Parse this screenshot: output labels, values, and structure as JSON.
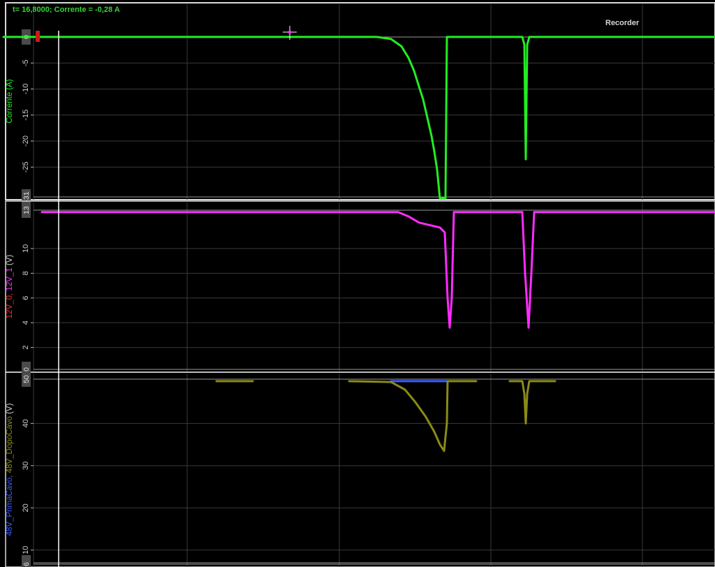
{
  "header": {
    "readout": "t= 16,8000; Corrente = -0,28 A",
    "recorder_label": "Recorder"
  },
  "colors": {
    "background": "#000000",
    "grid": "#3a3a3a",
    "panel_border": "#d8d8d8",
    "current": "#22ee22",
    "v12_0": "#e03030",
    "v12_1": "#ff2cff",
    "v48_prima": "#3a5cff",
    "v48_dopo": "#8a8a1a",
    "cursor": "#ffffff"
  },
  "chart_data": [
    {
      "type": "line",
      "panel": "current",
      "ylabel": "Corrente (A)",
      "ylim": [
        -31,
        1.2
      ],
      "yticks": [
        0,
        -5,
        -10,
        -15,
        -20,
        -25
      ],
      "ytick_labels": [
        "0",
        "-5",
        "-10",
        "-15",
        "-20",
        "-25"
      ],
      "ytick_boxed": [
        {
          "value": 0,
          "label": "0"
        },
        {
          "value": -31,
          "label": "-31"
        }
      ],
      "grid": true,
      "series": [
        {
          "name": "Corrente",
          "color": "#22ee22",
          "points": [
            [
              5,
              0
            ],
            [
              540,
              0
            ],
            [
              560,
              -0.4
            ],
            [
              575,
              -1.8
            ],
            [
              585,
              -4
            ],
            [
              593,
              -6.5
            ],
            [
              600,
              -9.5
            ],
            [
              606,
              -12
            ],
            [
              612,
              -15.5
            ],
            [
              618,
              -19
            ],
            [
              622,
              -22
            ],
            [
              626,
              -25.5
            ],
            [
              630,
              -31
            ],
            [
              634,
              -31
            ],
            [
              638,
              -31
            ],
            [
              640,
              0
            ],
            [
              645,
              0
            ],
            [
              748,
              0
            ],
            [
              751,
              -1.5
            ],
            [
              753,
              -23.5
            ],
            [
              755,
              -1.5
            ],
            [
              758,
              0
            ],
            [
              1024,
              0
            ]
          ]
        }
      ]
    },
    {
      "type": "line",
      "panel": "12v",
      "ylabel_parts": [
        {
          "text": "12V_0, ",
          "color": "#e03030"
        },
        {
          "text": "12V_1",
          "color": "#ff2cff"
        },
        {
          "text": " (V)",
          "color": "#d0d0d0"
        }
      ],
      "ylim": [
        0,
        13.1
      ],
      "yticks": [
        10,
        8,
        6,
        4,
        2
      ],
      "ytick_labels": [
        "10",
        "8",
        "6",
        "4",
        "2"
      ],
      "ytick_boxed": [
        {
          "value": 13.1,
          "label": "13"
        },
        {
          "value": 0,
          "label": "0"
        }
      ],
      "grid": true,
      "series": [
        {
          "name": "12V_1",
          "color": "#ff2cff",
          "points": [
            [
              60,
              12.95
            ],
            [
              570,
              12.95
            ],
            [
              585,
              12.6
            ],
            [
              600,
              12.1
            ],
            [
              615,
              11.9
            ],
            [
              630,
              11.7
            ],
            [
              637,
              11.3
            ],
            [
              641,
              6
            ],
            [
              644,
              3.6
            ],
            [
              647,
              6
            ],
            [
              650,
              12.95
            ],
            [
              748,
              12.95
            ],
            [
              752,
              8
            ],
            [
              757,
              3.6
            ],
            [
              761,
              8
            ],
            [
              765,
              12.95
            ],
            [
              1024,
              12.95
            ]
          ]
        }
      ]
    },
    {
      "type": "line",
      "panel": "48v",
      "ylabel_parts": [
        {
          "text": "48V_PrimaCavo",
          "color": "#3a5cff"
        },
        {
          "text": ", 48V_DopoCavo",
          "color": "#8a8a1a"
        },
        {
          "text": " (V)",
          "color": "#d0d0d0"
        }
      ],
      "ylim": [
        6,
        51.3
      ],
      "yticks": [
        40,
        30,
        20,
        10
      ],
      "ytick_labels": [
        "40",
        "30",
        "20",
        "10"
      ],
      "ytick_boxed": [
        {
          "value": 50.5,
          "label": "50"
        },
        {
          "value": 7,
          "label": "7.0"
        },
        {
          "value": 6,
          "label": "6"
        }
      ],
      "grid": true,
      "series": [
        {
          "name": "48V_PrimaCavo",
          "color": "#3a5cff",
          "points": [
            [
              560,
              50
            ],
            [
              640,
              50
            ]
          ]
        },
        {
          "name": "48V_DopoCavo",
          "color": "#8a8a1a",
          "segments": [
            [
              [
                310,
                50
              ],
              [
                362,
                50
              ]
            ],
            [
              [
                500,
                50
              ],
              [
                560,
                49.8
              ],
              [
                580,
                48
              ],
              [
                595,
                45
              ],
              [
                610,
                41.5
              ],
              [
                622,
                38
              ],
              [
                630,
                35
              ],
              [
                636,
                33.5
              ],
              [
                640,
                40
              ],
              [
                641,
                50
              ],
              [
                682,
                50
              ]
            ],
            [
              [
                730,
                50
              ],
              [
                748,
                50
              ],
              [
                751,
                47
              ],
              [
                753,
                40
              ],
              [
                755,
                47
              ],
              [
                758,
                50
              ],
              [
                795,
                50
              ]
            ]
          ]
        }
      ]
    }
  ],
  "x_gridlines": [
    48,
    268,
    486,
    703,
    920
  ]
}
